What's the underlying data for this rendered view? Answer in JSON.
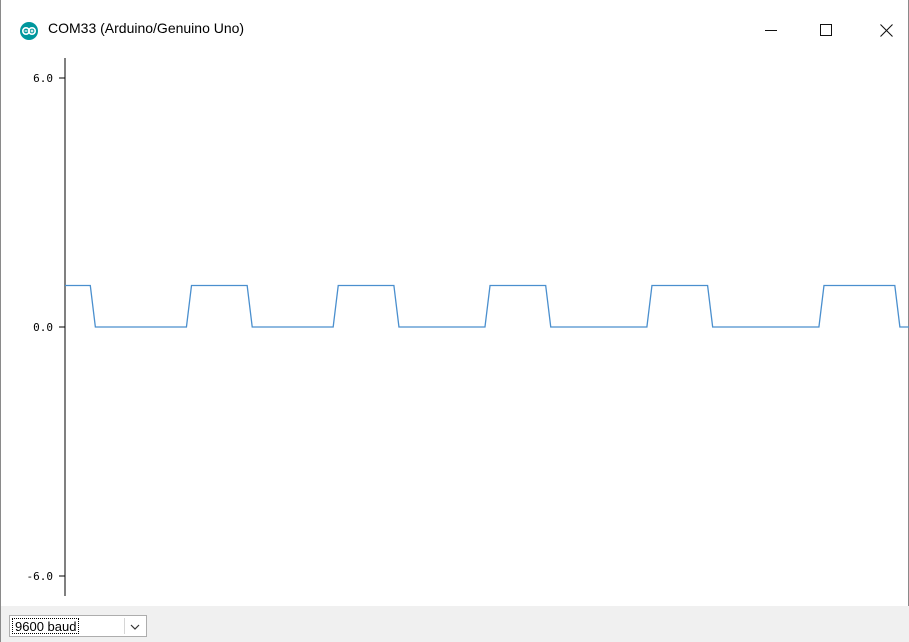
{
  "window": {
    "title": "COM33 (Arduino/Genuino Uno)",
    "app_icon": "arduino-logo-icon",
    "controls": [
      "minimize-icon",
      "maximize-icon",
      "close-icon"
    ]
  },
  "colors": {
    "series_line": "#4a8fce",
    "axis": "#000000",
    "bottom_bar": "#f0f0f0"
  },
  "chart_data": {
    "type": "line",
    "yticks": [
      "6.0",
      "0.0",
      "-6.0"
    ],
    "ylim": [
      -6.0,
      6.0
    ],
    "series": [
      {
        "values": [
          1,
          1,
          1,
          1,
          1,
          1,
          0,
          0,
          0,
          0,
          0,
          0,
          0,
          0,
          0,
          0,
          0,
          0,
          0,
          0,
          0,
          0,
          0,
          0,
          0,
          1,
          1,
          1,
          1,
          1,
          1,
          1,
          1,
          1,
          1,
          1,
          1,
          0,
          0,
          0,
          0,
          0,
          0,
          0,
          0,
          0,
          0,
          0,
          0,
          0,
          0,
          0,
          0,
          0,
          1,
          1,
          1,
          1,
          1,
          1,
          1,
          1,
          1,
          1,
          1,
          1,
          0,
          0,
          0,
          0,
          0,
          0,
          0,
          0,
          0,
          0,
          0,
          0,
          0,
          0,
          0,
          0,
          0,
          0,
          1,
          1,
          1,
          1,
          1,
          1,
          1,
          1,
          1,
          1,
          1,
          1,
          0,
          0,
          0,
          0,
          0,
          0,
          0,
          0,
          0,
          0,
          0,
          0,
          0,
          0,
          0,
          0,
          0,
          0,
          0,
          0,
          1,
          1,
          1,
          1,
          1,
          1,
          1,
          1,
          1,
          1,
          1,
          1,
          0,
          0,
          0,
          0,
          0,
          0,
          0,
          0,
          0,
          0,
          0,
          0,
          0,
          0,
          0,
          0,
          0,
          0,
          0,
          0,
          0,
          0,
          1,
          1,
          1,
          1,
          1,
          1,
          1,
          1,
          1,
          1,
          1,
          1,
          1,
          1,
          1,
          0,
          0,
          0
        ]
      }
    ]
  },
  "footer": {
    "baud_rate": "9600 baud"
  }
}
